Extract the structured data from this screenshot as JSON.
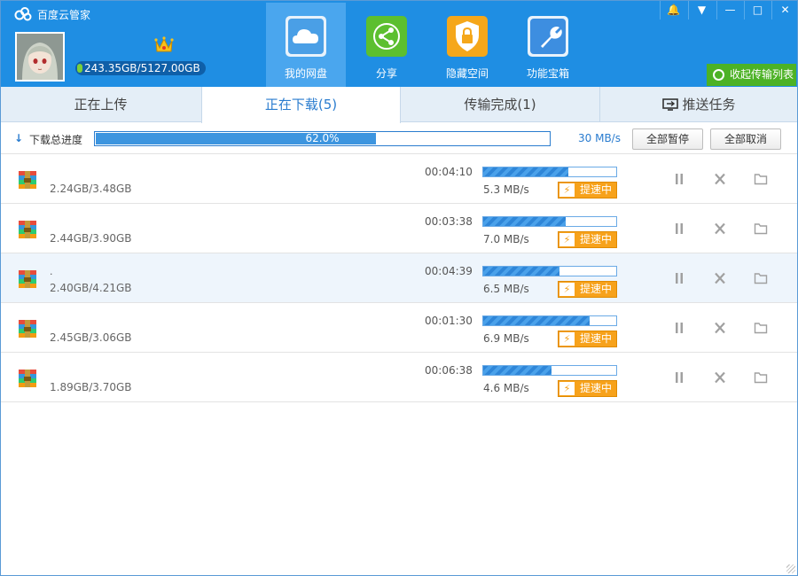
{
  "app": {
    "title": "百度云管家"
  },
  "account": {
    "quota": "243.35GB/5127.00GB"
  },
  "nav": [
    {
      "label": "我的网盘",
      "icon": "cloud-icon",
      "active": true
    },
    {
      "label": "分享",
      "icon": "share-icon",
      "active": false
    },
    {
      "label": "隐藏空间",
      "icon": "lock-icon",
      "active": false
    },
    {
      "label": "功能宝箱",
      "icon": "wrench-icon",
      "active": false
    }
  ],
  "collapse": {
    "label": "收起传输列表"
  },
  "tabs": [
    {
      "label": "正在上传"
    },
    {
      "label": "正在下载(5)",
      "active": true
    },
    {
      "label": "传输完成(1)"
    },
    {
      "label": "推送任务"
    }
  ],
  "total": {
    "label": "下载总进度",
    "percent_text": "62.0%",
    "percent": 62.0,
    "speed": "30 MB/s",
    "pause_all": "全部暂停",
    "cancel_all": "全部取消"
  },
  "downloads": [
    {
      "name": "",
      "size": "2.24GB/3.48GB",
      "time": "00:04:10",
      "progress": 0.64,
      "speed": "5.3 MB/s",
      "boost": "提速中"
    },
    {
      "name": "",
      "size": "2.44GB/3.90GB",
      "time": "00:03:38",
      "progress": 0.62,
      "speed": "7.0 MB/s",
      "boost": "提速中"
    },
    {
      "name": ".",
      "size": "2.40GB/4.21GB",
      "time": "00:04:39",
      "progress": 0.57,
      "speed": "6.5 MB/s",
      "boost": "提速中"
    },
    {
      "name": "",
      "size": "2.45GB/3.06GB",
      "time": "00:01:30",
      "progress": 0.8,
      "speed": "6.9 MB/s",
      "boost": "提速中"
    },
    {
      "name": "",
      "size": "1.89GB/3.70GB",
      "time": "00:06:38",
      "progress": 0.51,
      "speed": "4.6 MB/s",
      "boost": "提速中"
    }
  ],
  "colors": {
    "header": "#1f8ee3",
    "accent": "#2a7ccf",
    "boost": "#f7a21b",
    "collapse": "#4cb226"
  }
}
